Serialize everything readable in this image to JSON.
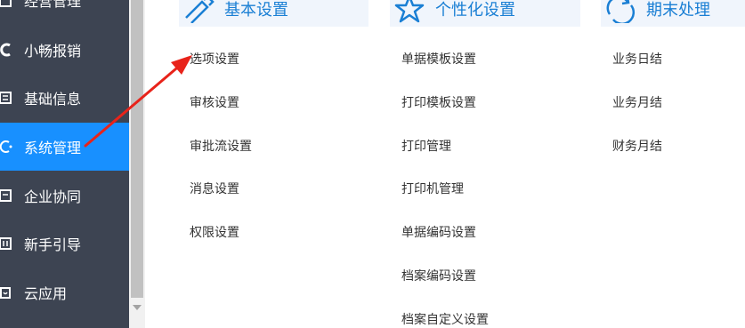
{
  "sidebar": {
    "items": [
      {
        "label": "经营管理",
        "icon": "management-icon"
      },
      {
        "label": "小畅报销",
        "icon": "reimbursement-icon"
      },
      {
        "label": "基础信息",
        "icon": "info-icon"
      },
      {
        "label": "系统管理",
        "icon": "system-icon",
        "active": true
      },
      {
        "label": "企业协同",
        "icon": "collaboration-icon"
      },
      {
        "label": "新手引导",
        "icon": "guide-icon"
      },
      {
        "label": "云应用",
        "icon": "cloud-app-icon"
      }
    ]
  },
  "groups": [
    {
      "title": "基本设置",
      "icon": "pencil-ruler-icon",
      "items": [
        "选项设置",
        "审核设置",
        "审批流设置",
        "消息设置",
        "权限设置"
      ]
    },
    {
      "title": "个性化设置",
      "icon": "star-icon",
      "items": [
        "单据模板设置",
        "打印模板设置",
        "打印管理",
        "打印机管理",
        "单据编码设置",
        "档案编码设置",
        "档案自定义设置"
      ]
    },
    {
      "title": "期末处理",
      "icon": "cycle-icon",
      "items": [
        "业务日结",
        "业务月结",
        "财务月结"
      ]
    }
  ],
  "colors": {
    "sidebar_bg": "#3d4452",
    "active_bg": "#1890ff",
    "header_bg": "#f0f5fc",
    "header_text": "#1a7fd4",
    "annotation_arrow": "#e8231a"
  }
}
